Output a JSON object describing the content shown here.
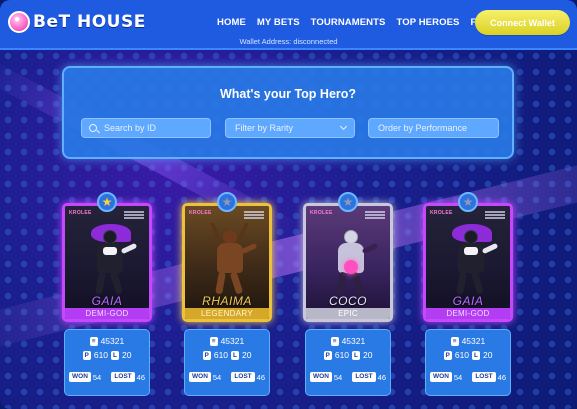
{
  "header": {
    "logo_text": "BeT HOUSE",
    "nav": [
      "HOME",
      "MY BETS",
      "TOURNAMENTS",
      "TOP HEROES",
      "FAQ"
    ],
    "connect_label": "Connect Wallet",
    "wallet_status": "Wallet Address: disconnected"
  },
  "panel": {
    "title": "What's your Top Hero?",
    "search_placeholder": "Search by ID",
    "rarity_label": "Filter by Rarity",
    "order_label": "Order by Performance"
  },
  "cards": [
    {
      "name": "GAIA",
      "rarity": "DEMI-GOD",
      "star": "gold",
      "id": "45321",
      "p": "610",
      "l": "20",
      "won_label": "WON",
      "won": "54",
      "lost_label": "LOST",
      "lost": "46",
      "corner": "KROLEE"
    },
    {
      "name": "RHAIMA",
      "rarity": "LEGENDARY",
      "star": "grey",
      "id": "45321",
      "p": "610",
      "l": "20",
      "won_label": "WON",
      "won": "54",
      "lost_label": "LOST",
      "lost": "46",
      "corner": "KROLEE"
    },
    {
      "name": "COCO",
      "rarity": "EPIC",
      "star": "grey",
      "id": "45321",
      "p": "610",
      "l": "20",
      "won_label": "WON",
      "won": "54",
      "lost_label": "LOST",
      "lost": "46",
      "corner": "KROLEE"
    },
    {
      "name": "GAIA",
      "rarity": "DEMI-GOD",
      "star": "grey",
      "id": "45321",
      "p": "610",
      "l": "20",
      "won_label": "WON",
      "won": "54",
      "lost_label": "LOST",
      "lost": "46",
      "corner": "KROLEE"
    }
  ],
  "labels": {
    "id_chip": "≡",
    "p_chip": "P",
    "l_chip": "L"
  },
  "colors": {
    "header_bg": "#1f5be0",
    "connect_bg": "#e6de3a",
    "demigod": "#b23df2",
    "legendary": "#d6a82a",
    "epic": "#b7b7c7"
  }
}
